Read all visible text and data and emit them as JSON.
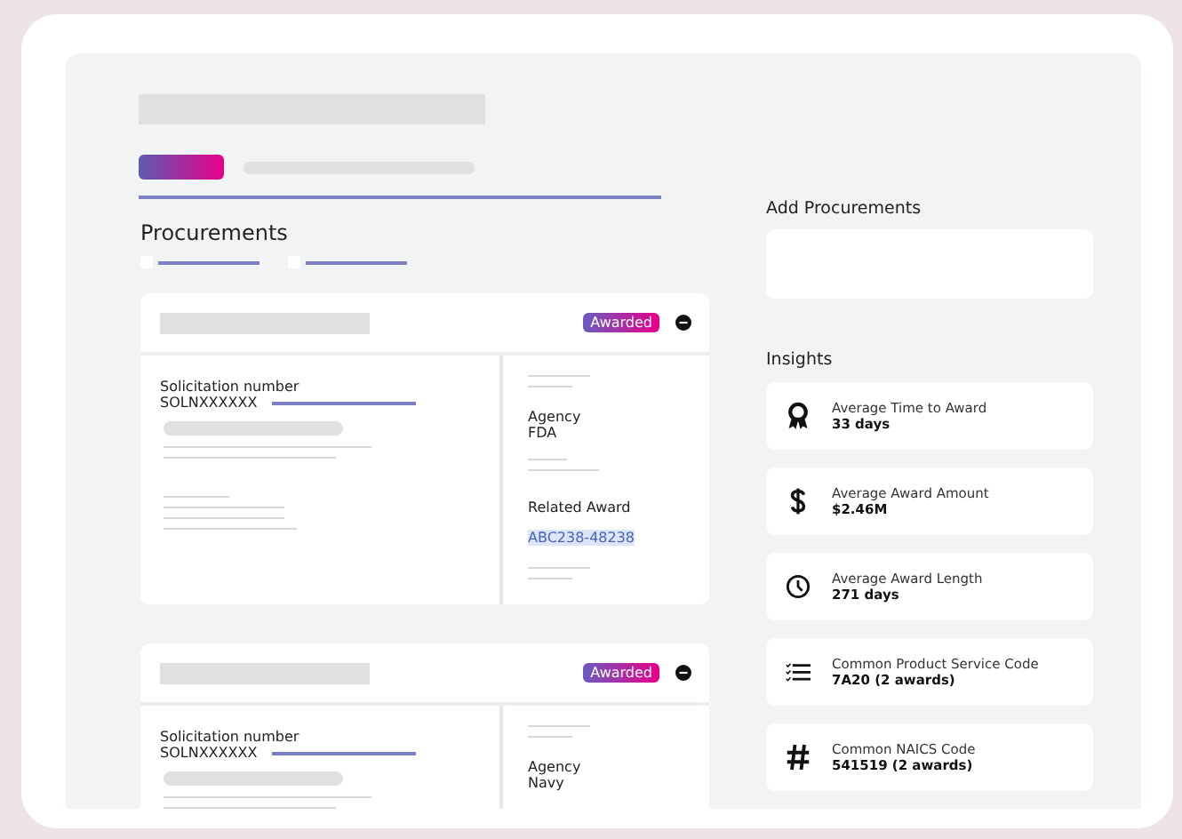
{
  "main": {
    "heading": "Procurements",
    "filters": [
      {
        "checked": false
      },
      {
        "checked": false
      }
    ],
    "cards": [
      {
        "status": "Awarded",
        "solicitation_label": "Solicitation number",
        "solicitation_value": "SOLNXXXXXX",
        "agency_label": "Agency",
        "agency_value": "FDA",
        "related_label": "Related Award",
        "related_value": "ABC238-48238"
      },
      {
        "status": "Awarded",
        "solicitation_label": "Solicitation number",
        "solicitation_value": "SOLNXXXXXX",
        "agency_label": "Agency",
        "agency_value": "Navy"
      }
    ]
  },
  "sidebar": {
    "add_title": "Add Procurements",
    "insights_title": "Insights",
    "insights": [
      {
        "kind": "award",
        "label": "Average Time to Award",
        "value": "33 days"
      },
      {
        "kind": "dollar",
        "label": "Average Award Amount",
        "value": "$2.46M"
      },
      {
        "kind": "clock",
        "label": "Average Award Length",
        "value": "271 days"
      },
      {
        "kind": "list",
        "label": "Common Product Service Code",
        "value": "7A20 (2 awards)"
      },
      {
        "kind": "hash",
        "label": "Common NAICS Code",
        "value": "541519 (2 awards)"
      }
    ]
  }
}
